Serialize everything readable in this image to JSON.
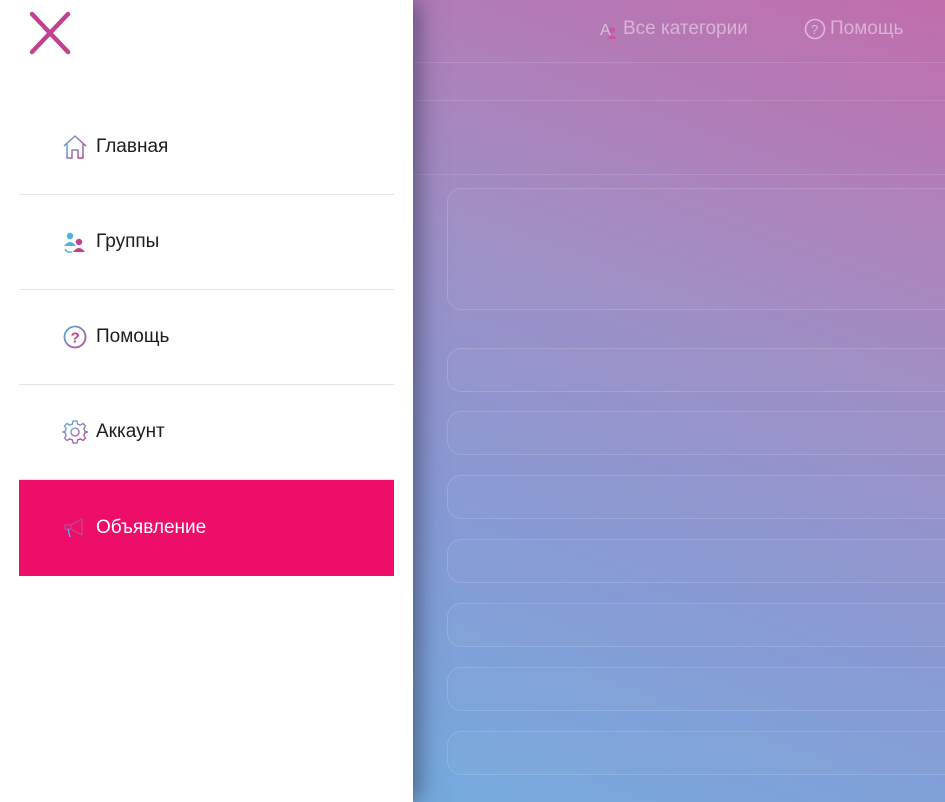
{
  "header": {
    "categories_label": "Все категории",
    "help_label": "Помощь"
  },
  "drawer": {
    "close_icon": "close-x-icon",
    "items": [
      {
        "label": "Главная",
        "icon": "home-icon"
      },
      {
        "label": "Группы",
        "icon": "groups-icon"
      },
      {
        "label": "Помощь",
        "icon": "help-icon"
      },
      {
        "label": "Аккаунт",
        "icon": "gear-icon"
      },
      {
        "label": "Объявление",
        "icon": "megaphone-icon",
        "active": true
      }
    ]
  },
  "colors": {
    "accent": "#ee0e6a",
    "icon_pink": "#c2418f",
    "icon_blue": "#4fb0e4",
    "drawer_bg": "#ffffff"
  }
}
